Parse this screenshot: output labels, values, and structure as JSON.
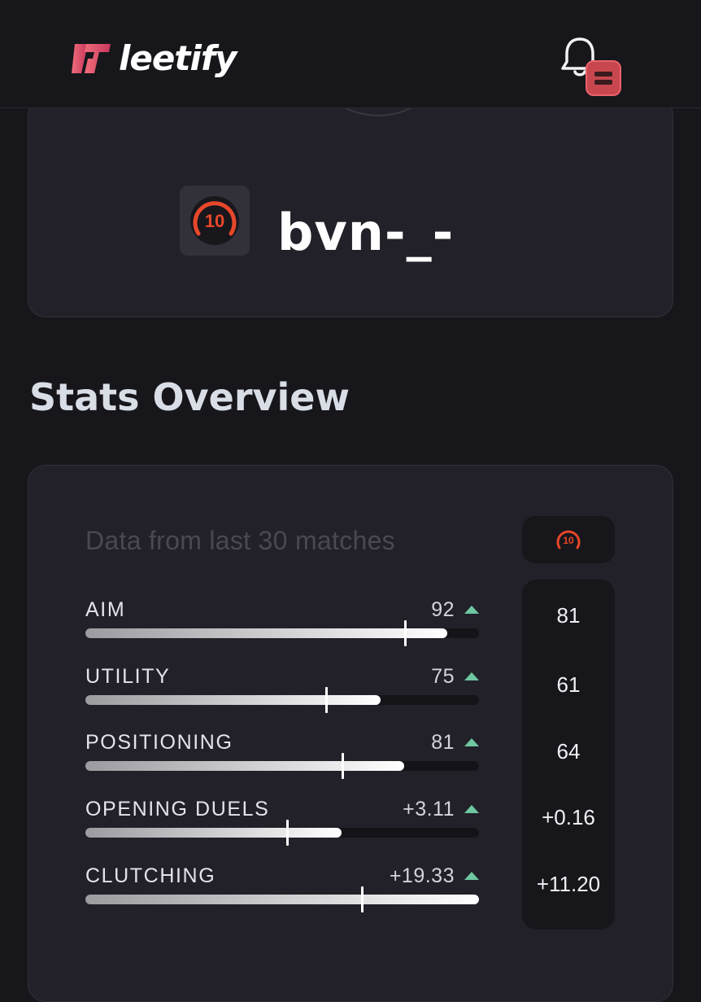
{
  "header": {
    "logo_text": "leetify",
    "brand_color": "#e0506a",
    "notification_icon": "bell-icon"
  },
  "profile": {
    "rank_level": "10",
    "player_name": "bvn-_-"
  },
  "stats_overview": {
    "title": "Stats Overview",
    "subtitle": "Data from last 30 matches",
    "rank_badge_level": "10",
    "rows": [
      {
        "label": "AIM",
        "value": "92",
        "trend": "up",
        "comparison": "81",
        "fill_fraction": 0.92,
        "marker_fraction": 0.81
      },
      {
        "label": "UTILITY",
        "value": "75",
        "trend": "up",
        "comparison": "61",
        "fill_fraction": 0.75,
        "marker_fraction": 0.61
      },
      {
        "label": "POSITIONING",
        "value": "81",
        "trend": "up",
        "comparison": "64",
        "fill_fraction": 0.81,
        "marker_fraction": 0.65
      },
      {
        "label": "OPENING DUELS",
        "value": "+3.11",
        "trend": "up",
        "comparison": "+0.16",
        "fill_fraction": 0.65,
        "marker_fraction": 0.51
      },
      {
        "label": "CLUTCHING",
        "value": "+19.33",
        "trend": "up",
        "comparison": "+11.20",
        "fill_fraction": 1.0,
        "marker_fraction": 0.7
      }
    ]
  },
  "colors": {
    "background": "#17161b",
    "card": "#222129",
    "trend_up": "#6ec7a1",
    "rank_ring": "#e8472a"
  }
}
